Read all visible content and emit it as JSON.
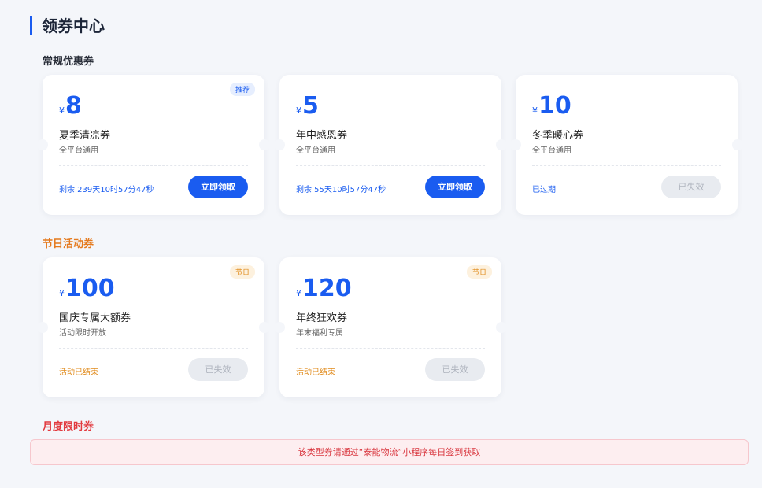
{
  "page": {
    "title": "领券中心"
  },
  "sections": {
    "regular": "常规优惠券",
    "holiday": "节日活动券",
    "monthly": "月度限时券"
  },
  "currency": "¥",
  "coupons": [
    {
      "badge": "推荐",
      "amount": "8",
      "name": "夏季清凉券",
      "desc": "全平台通用",
      "status": "剩余 239天10时57分47秒",
      "button": "立即领取"
    },
    {
      "badge": "",
      "amount": "5",
      "name": "年中感恩券",
      "desc": "全平台通用",
      "status": "剩余 55天10时57分47秒",
      "button": "立即领取"
    },
    {
      "badge": "",
      "amount": "10",
      "name": "冬季暖心券",
      "desc": "全平台通用",
      "status": "已过期",
      "button": "已失效"
    },
    {
      "badge": "节日",
      "amount": "100",
      "name": "国庆专属大额券",
      "desc": "活动限时开放",
      "status": "活动已结束",
      "button": "已失效"
    },
    {
      "badge": "节日",
      "amount": "120",
      "name": "年终狂欢券",
      "desc": "年末福利专属",
      "status": "活动已结束",
      "button": "已失效"
    }
  ],
  "notice": "该类型券请通过“泰能物流”小程序每日签到获取",
  "colors": {
    "primary": "#1a5cf0",
    "holiday": "#e57a1e",
    "monthly": "#e2393e"
  }
}
